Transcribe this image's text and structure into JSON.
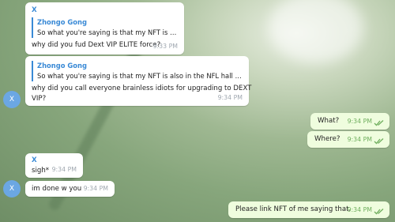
{
  "messages": {
    "m1": {
      "sender": "X",
      "reply_name": "Zhongo Gong",
      "reply_text": "So what you're saying is that my NFT is also ...",
      "text": "why did you fud Dext VIP ELITE force?",
      "time": "9:33 PM"
    },
    "m2": {
      "reply_name": "Zhongo Gong",
      "reply_text": "So what you're saying is that my NFT is also in the NFL hall of fa...",
      "text_line1": "why did you call everyone brainless idiots for upgrading to DEXT",
      "text_line2": "VIP?",
      "time": "9:34 PM"
    },
    "m3": {
      "text": "What?",
      "time": "9:34 PM"
    },
    "m4": {
      "text": "Where?",
      "time": "9:34 PM"
    },
    "m5": {
      "sender": "X",
      "text": "sigh*",
      "time": "9:34 PM"
    },
    "m6": {
      "text": "im done w you",
      "time": "9:34 PM"
    },
    "m7": {
      "text": "Please link NFT of me saying that.",
      "time": "9:34 PM"
    }
  },
  "avatar_letter": "X",
  "icons": {
    "read_receipt": "double-check-icon"
  },
  "colors": {
    "incoming": "#ffffff",
    "outgoing": "#effdde",
    "accent": "#3a8ad6",
    "avatar": "#6ba7e3",
    "check": "#6fae5e"
  }
}
